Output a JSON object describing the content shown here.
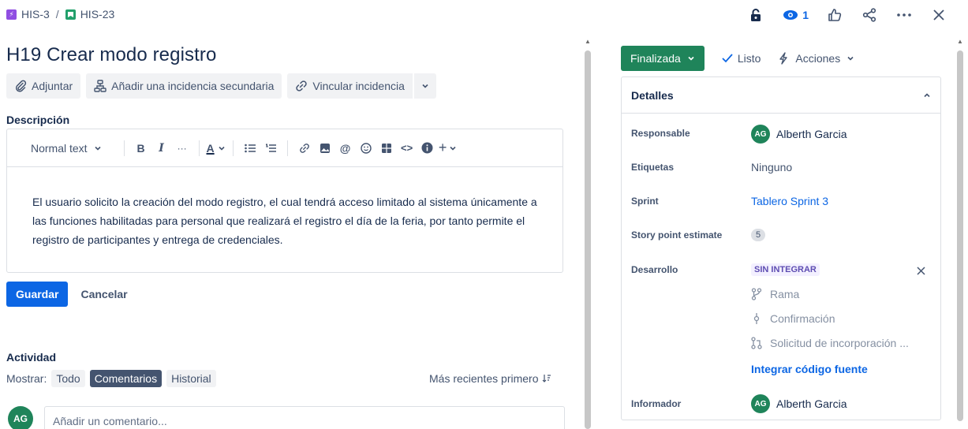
{
  "breadcrumb": {
    "epic_key": "HIS-3",
    "separator": "/",
    "story_key": "HIS-23"
  },
  "top_actions": {
    "watchers_count": "1"
  },
  "issue": {
    "title": "H19 Crear modo registro"
  },
  "toolbar": {
    "attach_label": "Adjuntar",
    "add_child_label": "Añadir una incidencia secundaria",
    "link_issue_label": "Vincular incidencia"
  },
  "description": {
    "label": "Descripción",
    "text_style": "Normal text",
    "body": "El usuario solicito la creación del modo registro, el cual tendrá acceso limitado al sistema únicamente a las funciones habilitadas para personal que realizará el registro el día de la feria, por tanto permite el registro de participantes y entrega de credenciales."
  },
  "editor_actions": {
    "save_label": "Guardar",
    "cancel_label": "Cancelar"
  },
  "activity": {
    "heading": "Actividad",
    "show_label": "Mostrar:",
    "filters": [
      "Todo",
      "Comentarios",
      "Historial"
    ],
    "active_filter": "Comentarios",
    "sort_label": "Más recientes primero",
    "comment_placeholder": "Añadir un comentario...",
    "user_initials": "AG"
  },
  "status": {
    "current": "Finalizada",
    "resolution": "Listo",
    "actions_label": "Acciones",
    "status_color": "#1f845a"
  },
  "details": {
    "heading": "Detalles",
    "fields": {
      "assignee_label": "Responsable",
      "assignee_initials": "AG",
      "assignee_name": "Alberth Garcia",
      "labels_label": "Etiquetas",
      "labels_value": "Ninguno",
      "sprint_label": "Sprint",
      "sprint_value": "Tablero Sprint 3",
      "story_points_label": "Story point estimate",
      "story_points_value": "5",
      "development_label": "Desarrollo",
      "development_status": "SIN INTEGRAR",
      "dev_branch": "Rama",
      "dev_commit": "Confirmación",
      "dev_pr": "Solicitud de incorporación ...",
      "dev_integrate": "Integrar código fuente",
      "reporter_label": "Informador",
      "reporter_initials": "AG",
      "reporter_name": "Alberth Garcia"
    }
  },
  "colors": {
    "accent": "#0c66e4",
    "success": "#1f845a",
    "text": "#172b4d",
    "subtle_text": "#44546f",
    "border": "#dcdfe4"
  }
}
